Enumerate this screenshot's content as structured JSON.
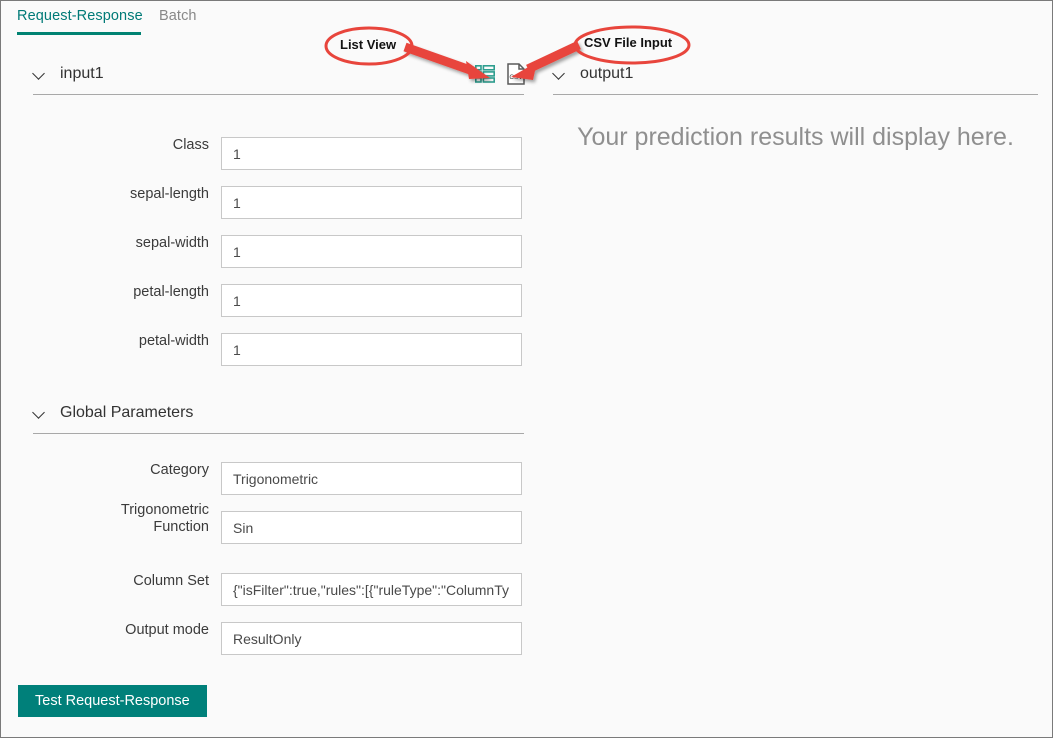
{
  "tabs": [
    {
      "id": "request-response",
      "label": "Request-Response",
      "active": true
    },
    {
      "id": "batch",
      "label": "Batch",
      "active": false
    }
  ],
  "toolbar": {
    "list_view_icon": "list-view-icon",
    "csv_file_input_icon": "csv-file-icon"
  },
  "annotations": [
    {
      "id": "list-view",
      "label": "List View",
      "color": "#e8453c"
    },
    {
      "id": "csv-file-input",
      "label": "CSV File Input",
      "color": "#e8453c"
    }
  ],
  "input_section": {
    "title": "input1",
    "fields": [
      {
        "label": "Class",
        "value": "1"
      },
      {
        "label": "sepal-length",
        "value": "1"
      },
      {
        "label": "sepal-width",
        "value": "1"
      },
      {
        "label": "petal-length",
        "value": "1"
      },
      {
        "label": "petal-width",
        "value": "1"
      }
    ]
  },
  "global_parameters": {
    "title": "Global Parameters",
    "fields": [
      {
        "label": "Category",
        "value": "Trigonometric"
      },
      {
        "label": "Trigonometric Function",
        "value": "Sin"
      },
      {
        "label": "Column Set",
        "value": "{\"isFilter\":true,\"rules\":[{\"ruleType\":\"ColumnTy"
      },
      {
        "label": "Output mode",
        "value": "ResultOnly"
      }
    ]
  },
  "output_section": {
    "title": "output1",
    "placeholder": "Your prediction results will display here."
  },
  "actions": {
    "test_button_label": "Test Request-Response"
  },
  "colors": {
    "accent": "#008272",
    "button": "#00807a",
    "annotation": "#e8453c",
    "background": "#fafafa",
    "muted_text": "#8f8f8f"
  }
}
